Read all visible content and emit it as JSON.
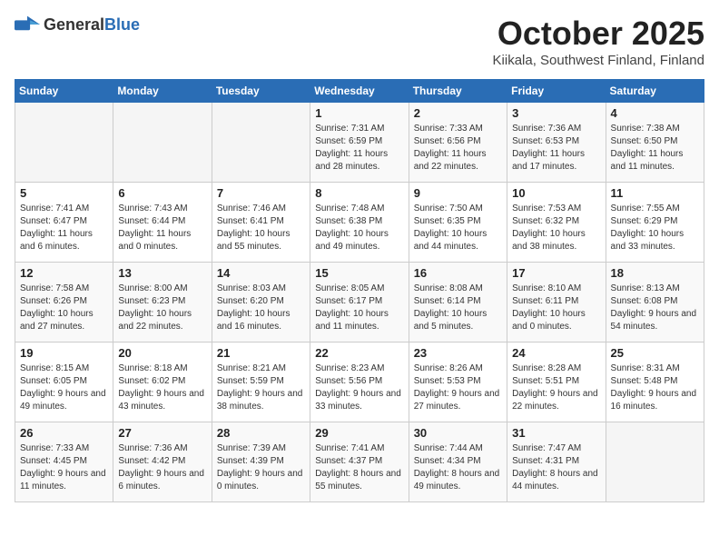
{
  "header": {
    "logo_general": "General",
    "logo_blue": "Blue",
    "month": "October 2025",
    "location": "Kiikala, Southwest Finland, Finland"
  },
  "days_of_week": [
    "Sunday",
    "Monday",
    "Tuesday",
    "Wednesday",
    "Thursday",
    "Friday",
    "Saturday"
  ],
  "weeks": [
    [
      {
        "day": "",
        "empty": true
      },
      {
        "day": "",
        "empty": true
      },
      {
        "day": "",
        "empty": true
      },
      {
        "day": "1",
        "sunrise": "7:31 AM",
        "sunset": "6:59 PM",
        "daylight": "11 hours and 28 minutes."
      },
      {
        "day": "2",
        "sunrise": "7:33 AM",
        "sunset": "6:56 PM",
        "daylight": "11 hours and 22 minutes."
      },
      {
        "day": "3",
        "sunrise": "7:36 AM",
        "sunset": "6:53 PM",
        "daylight": "11 hours and 17 minutes."
      },
      {
        "day": "4",
        "sunrise": "7:38 AM",
        "sunset": "6:50 PM",
        "daylight": "11 hours and 11 minutes."
      }
    ],
    [
      {
        "day": "5",
        "sunrise": "7:41 AM",
        "sunset": "6:47 PM",
        "daylight": "11 hours and 6 minutes."
      },
      {
        "day": "6",
        "sunrise": "7:43 AM",
        "sunset": "6:44 PM",
        "daylight": "11 hours and 0 minutes."
      },
      {
        "day": "7",
        "sunrise": "7:46 AM",
        "sunset": "6:41 PM",
        "daylight": "10 hours and 55 minutes."
      },
      {
        "day": "8",
        "sunrise": "7:48 AM",
        "sunset": "6:38 PM",
        "daylight": "10 hours and 49 minutes."
      },
      {
        "day": "9",
        "sunrise": "7:50 AM",
        "sunset": "6:35 PM",
        "daylight": "10 hours and 44 minutes."
      },
      {
        "day": "10",
        "sunrise": "7:53 AM",
        "sunset": "6:32 PM",
        "daylight": "10 hours and 38 minutes."
      },
      {
        "day": "11",
        "sunrise": "7:55 AM",
        "sunset": "6:29 PM",
        "daylight": "10 hours and 33 minutes."
      }
    ],
    [
      {
        "day": "12",
        "sunrise": "7:58 AM",
        "sunset": "6:26 PM",
        "daylight": "10 hours and 27 minutes."
      },
      {
        "day": "13",
        "sunrise": "8:00 AM",
        "sunset": "6:23 PM",
        "daylight": "10 hours and 22 minutes."
      },
      {
        "day": "14",
        "sunrise": "8:03 AM",
        "sunset": "6:20 PM",
        "daylight": "10 hours and 16 minutes."
      },
      {
        "day": "15",
        "sunrise": "8:05 AM",
        "sunset": "6:17 PM",
        "daylight": "10 hours and 11 minutes."
      },
      {
        "day": "16",
        "sunrise": "8:08 AM",
        "sunset": "6:14 PM",
        "daylight": "10 hours and 5 minutes."
      },
      {
        "day": "17",
        "sunrise": "8:10 AM",
        "sunset": "6:11 PM",
        "daylight": "10 hours and 0 minutes."
      },
      {
        "day": "18",
        "sunrise": "8:13 AM",
        "sunset": "6:08 PM",
        "daylight": "9 hours and 54 minutes."
      }
    ],
    [
      {
        "day": "19",
        "sunrise": "8:15 AM",
        "sunset": "6:05 PM",
        "daylight": "9 hours and 49 minutes."
      },
      {
        "day": "20",
        "sunrise": "8:18 AM",
        "sunset": "6:02 PM",
        "daylight": "9 hours and 43 minutes."
      },
      {
        "day": "21",
        "sunrise": "8:21 AM",
        "sunset": "5:59 PM",
        "daylight": "9 hours and 38 minutes."
      },
      {
        "day": "22",
        "sunrise": "8:23 AM",
        "sunset": "5:56 PM",
        "daylight": "9 hours and 33 minutes."
      },
      {
        "day": "23",
        "sunrise": "8:26 AM",
        "sunset": "5:53 PM",
        "daylight": "9 hours and 27 minutes."
      },
      {
        "day": "24",
        "sunrise": "8:28 AM",
        "sunset": "5:51 PM",
        "daylight": "9 hours and 22 minutes."
      },
      {
        "day": "25",
        "sunrise": "8:31 AM",
        "sunset": "5:48 PM",
        "daylight": "9 hours and 16 minutes."
      }
    ],
    [
      {
        "day": "26",
        "sunrise": "7:33 AM",
        "sunset": "4:45 PM",
        "daylight": "9 hours and 11 minutes."
      },
      {
        "day": "27",
        "sunrise": "7:36 AM",
        "sunset": "4:42 PM",
        "daylight": "9 hours and 6 minutes."
      },
      {
        "day": "28",
        "sunrise": "7:39 AM",
        "sunset": "4:39 PM",
        "daylight": "9 hours and 0 minutes."
      },
      {
        "day": "29",
        "sunrise": "7:41 AM",
        "sunset": "4:37 PM",
        "daylight": "8 hours and 55 minutes."
      },
      {
        "day": "30",
        "sunrise": "7:44 AM",
        "sunset": "4:34 PM",
        "daylight": "8 hours and 49 minutes."
      },
      {
        "day": "31",
        "sunrise": "7:47 AM",
        "sunset": "4:31 PM",
        "daylight": "8 hours and 44 minutes."
      },
      {
        "day": "",
        "empty": true
      }
    ]
  ],
  "labels": {
    "sunrise": "Sunrise:",
    "sunset": "Sunset:",
    "daylight": "Daylight:"
  }
}
